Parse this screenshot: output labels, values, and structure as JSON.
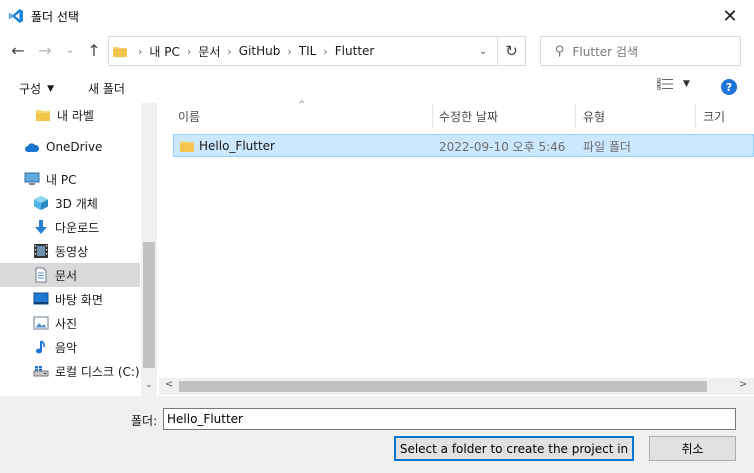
{
  "window": {
    "title": "폴더 선택",
    "close_glyph": "✕"
  },
  "nav": {
    "back_glyph": "←",
    "forward_glyph": "→",
    "recent_glyph": "⌄",
    "up_glyph": "↑",
    "refresh_glyph": "↻",
    "breadcrumbs": [
      "내 PC",
      "문서",
      "GitHub",
      "TIL",
      "Flutter"
    ],
    "crumb_separator": "›",
    "search_placeholder": "Flutter 검색"
  },
  "toolbar": {
    "organize_label": "구성",
    "new_folder_label": "새 폴더",
    "help_label": "?"
  },
  "sidebar": {
    "items": [
      {
        "label": "내 라벨",
        "icon": "folder-icon"
      },
      {
        "label": "OneDrive",
        "icon": "cloud-icon"
      },
      {
        "label": "내 PC",
        "icon": "computer-icon"
      },
      {
        "label": "3D 개체",
        "icon": "cube-icon"
      },
      {
        "label": "다운로드",
        "icon": "download-icon"
      },
      {
        "label": "동영상",
        "icon": "video-icon"
      },
      {
        "label": "문서",
        "icon": "document-icon",
        "selected": true
      },
      {
        "label": "바탕 화면",
        "icon": "desktop-icon"
      },
      {
        "label": "사진",
        "icon": "picture-icon"
      },
      {
        "label": "음악",
        "icon": "music-icon"
      },
      {
        "label": "로컬 디스크 (C:)",
        "icon": "drive-icon"
      }
    ]
  },
  "filelist": {
    "columns": [
      "이름",
      "수정한 날짜",
      "유형",
      "크기"
    ],
    "rows": [
      {
        "name": "Hello_Flutter",
        "modified": "2022-09-10 오후 5:46",
        "type": "파일 폴더",
        "size": ""
      }
    ]
  },
  "footer": {
    "folder_label": "폴더:",
    "folder_value": "Hello_Flutter",
    "select_label": "Select a folder to create the project in",
    "cancel_label": "취소"
  },
  "colors": {
    "accent": "#0078d7",
    "selection_bg": "#cce8ff",
    "folder_yellow": "#f8d775"
  }
}
